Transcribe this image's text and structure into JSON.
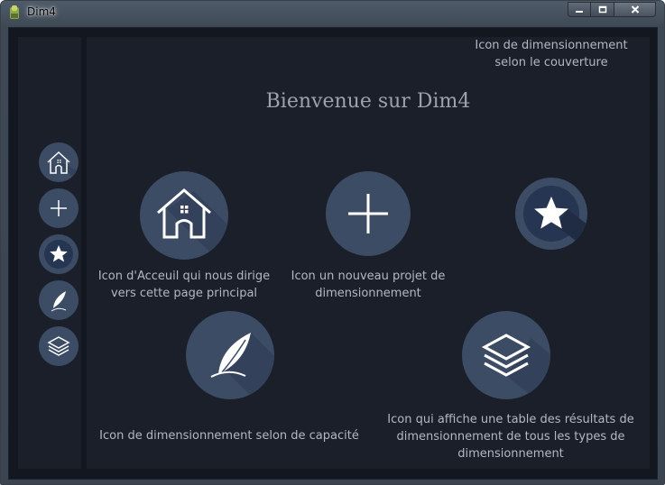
{
  "window": {
    "title": "Dim4",
    "controls": {
      "minimize": "minimize-icon",
      "maximize": "maximize-icon",
      "close": "close-icon"
    }
  },
  "sidebar": {
    "items": [
      {
        "name": "home",
        "icon": "home-icon"
      },
      {
        "name": "new-project",
        "icon": "plus-icon"
      },
      {
        "name": "coverage",
        "icon": "star-icon"
      },
      {
        "name": "capacity",
        "icon": "feather-icon"
      },
      {
        "name": "results",
        "icon": "layers-icon"
      }
    ]
  },
  "main": {
    "heading": "Bienvenue sur Dim4",
    "cards": [
      {
        "icon": "home-icon",
        "line1": "Icon d'Acceuil qui nous dirige",
        "line2": "vers cette page principal"
      },
      {
        "icon": "plus-icon",
        "line1": "Icon un nouveau projet de",
        "line2": "dimensionnement"
      },
      {
        "icon": "star-icon",
        "line1": "Icon de dimensionnement",
        "line2": "selon le couverture"
      },
      {
        "icon": "feather-icon",
        "line1": "Icon de dimensionnement selon de capacité"
      },
      {
        "icon": "layers-icon",
        "line1": "Icon qui affiche une table des résultats de",
        "line2": "dimensionnement de tous les types de",
        "line3": "dimensionnement"
      }
    ]
  },
  "colors": {
    "background": "#121720",
    "panel": "#1a1f2a",
    "circle": "#3c4c65",
    "heading": "#9aa3ae",
    "text": "#b2b9c3"
  }
}
